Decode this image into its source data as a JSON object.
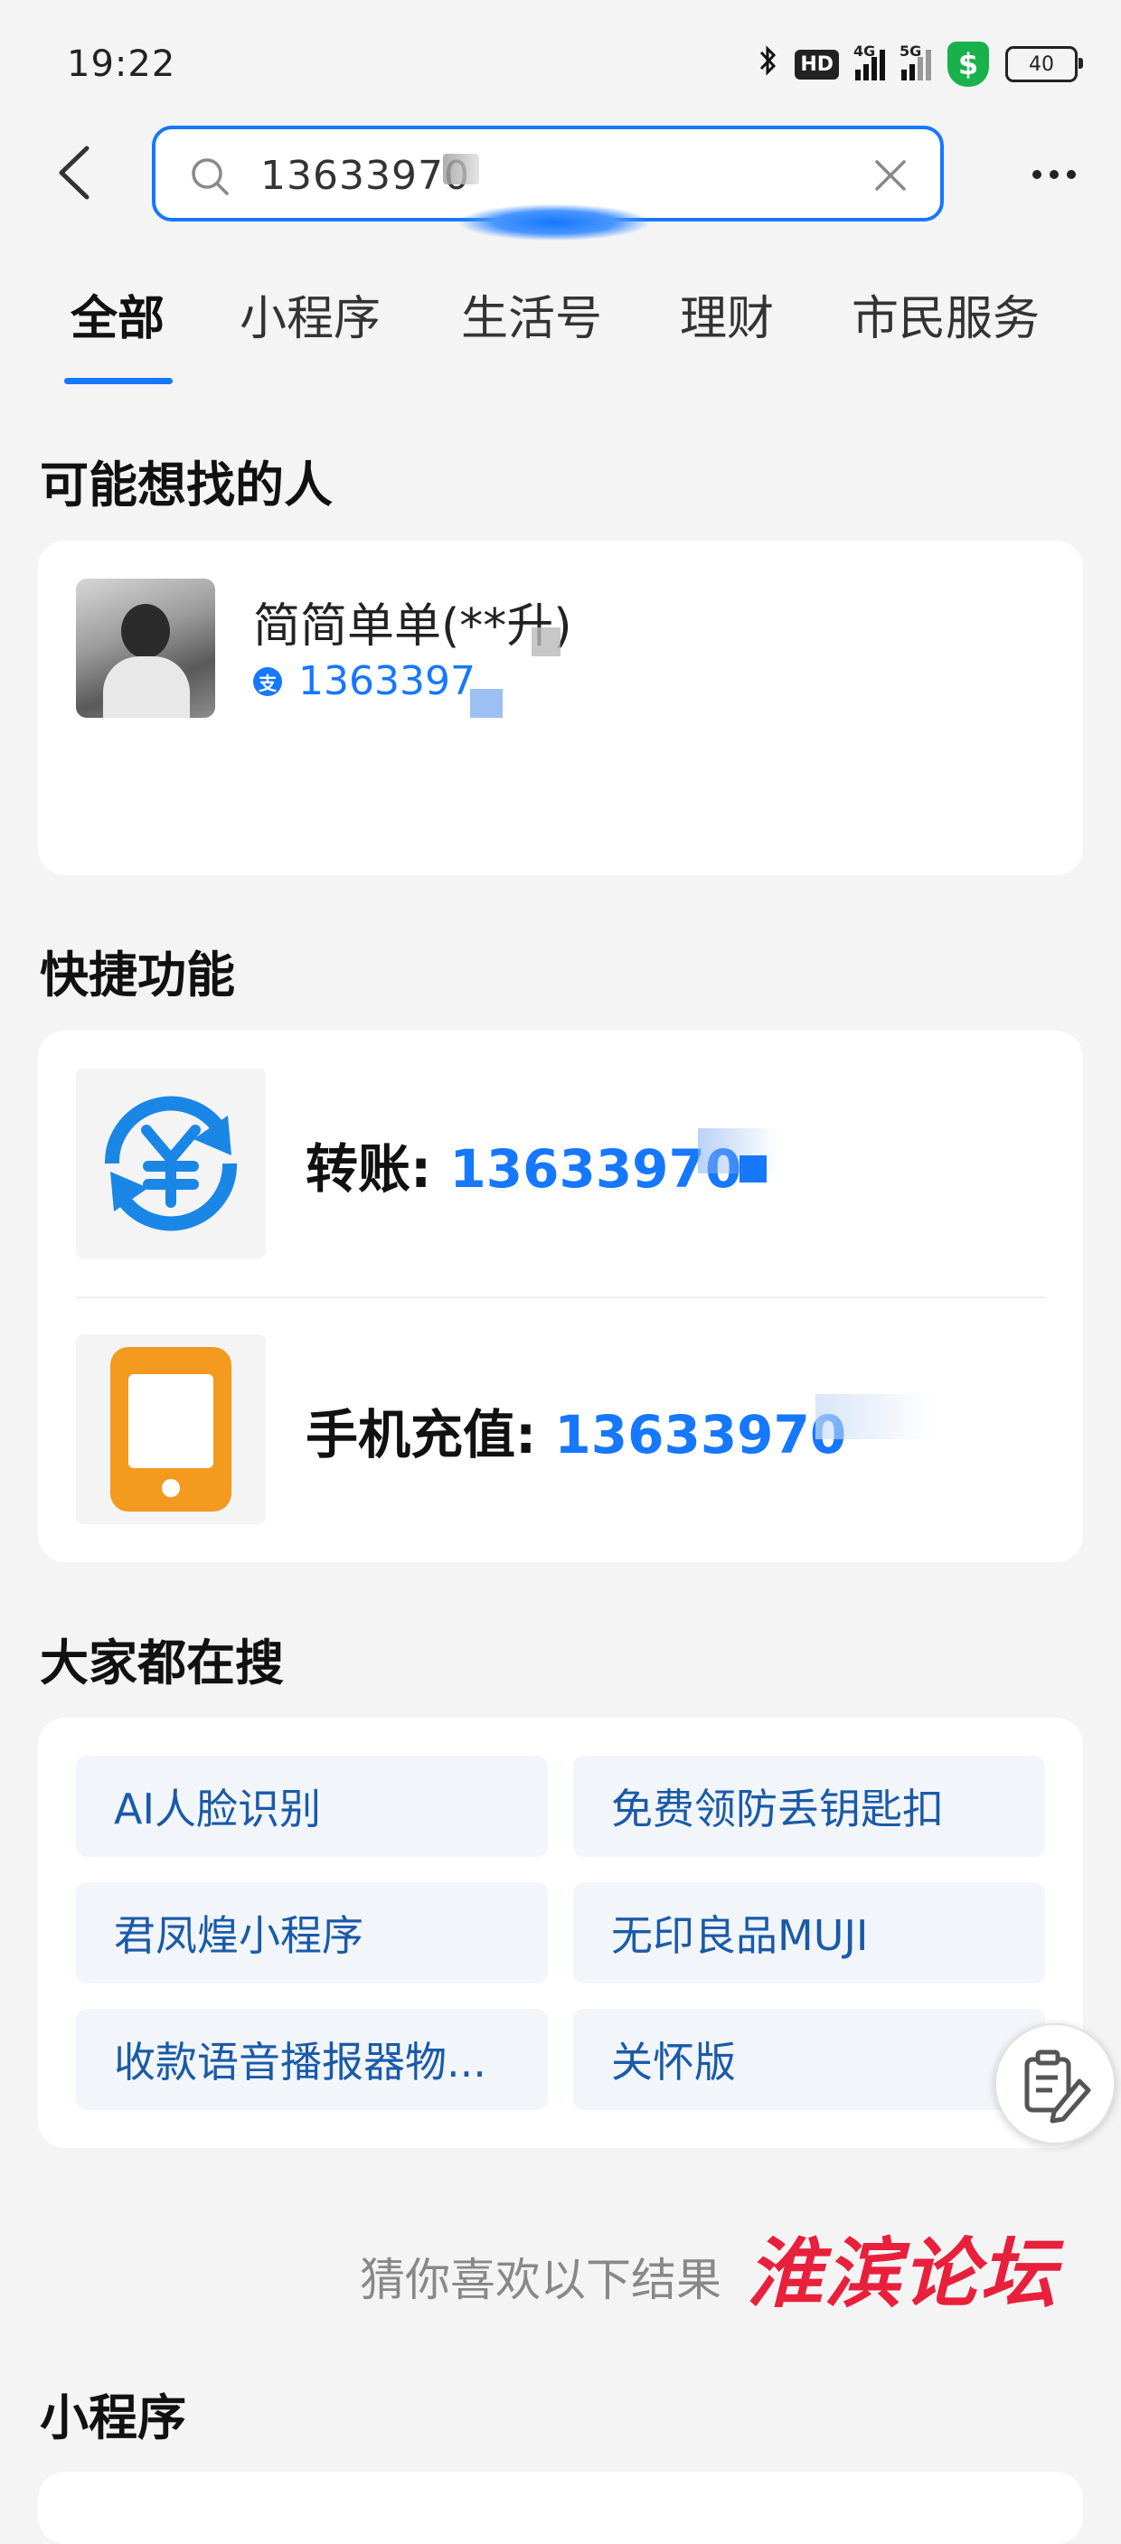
{
  "status_bar": {
    "time": "19:22",
    "hd": "HD",
    "net_4g": "4G",
    "net_5g": "5G",
    "battery": "40"
  },
  "search": {
    "query": "13633970"
  },
  "tabs": [
    {
      "label": "全部",
      "active": true
    },
    {
      "label": "小程序"
    },
    {
      "label": "生活号"
    },
    {
      "label": "理财"
    },
    {
      "label": "市民服务"
    }
  ],
  "people": {
    "title": "可能想找的人",
    "name": "简简单单(**升)",
    "alipay_badge": "支",
    "account": "1363397"
  },
  "quick": {
    "title": "快捷功能",
    "items": [
      {
        "label": "转账: ",
        "value": "13633970",
        "icon": "transfer-yuan-icon"
      },
      {
        "label": "手机充值: ",
        "value": "13633970",
        "icon": "phone-recharge-icon"
      }
    ]
  },
  "hot": {
    "title": "大家都在搜",
    "items": [
      "AI人脸识别",
      "免费领防丢钥匙扣",
      "君凤煌小程序",
      "无印良品MUJI",
      "收款语音播报器物...",
      "关怀版"
    ]
  },
  "guess_text": "猜你喜欢以下结果",
  "watermark": "淮滨论坛",
  "mini_title": "小程序",
  "colors": {
    "accent": "#1677ff",
    "transfer": "#1a86e6",
    "phone": "#f39a1f",
    "watermark": "#e8203c"
  }
}
